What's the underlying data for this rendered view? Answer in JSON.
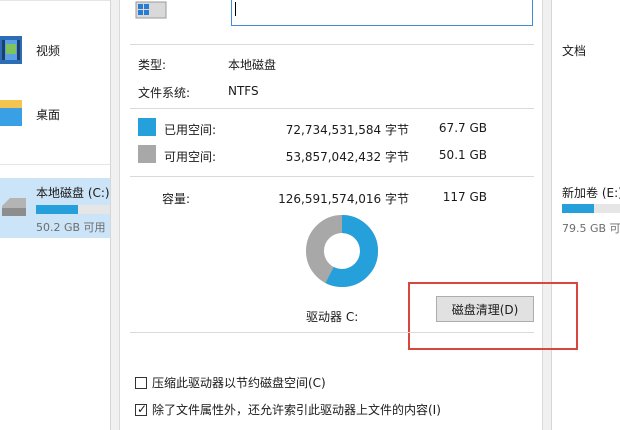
{
  "explorer": {
    "folders": [
      {
        "label": "视频",
        "icon": "video-folder-icon"
      },
      {
        "label": "桌面",
        "icon": "desktop-folder-icon"
      }
    ],
    "drive_c": {
      "label": "本地磁盘 (C:)",
      "free_text": "50.2 GB 可用",
      "used_fraction": 0.57
    },
    "right": {
      "doc_label": "文档",
      "drive_e": {
        "label": "新加卷 (E:)",
        "free_text": "79.5 GB 可",
        "used_fraction": 0.55
      }
    }
  },
  "properties": {
    "name_value": "",
    "type_label": "类型:",
    "type_value": "本地磁盘",
    "fs_label": "文件系统:",
    "fs_value": "NTFS",
    "used": {
      "label": "已用空间:",
      "bytes": "72,734,531,584 字节",
      "gb": "67.7 GB",
      "color": "#26a0da"
    },
    "free": {
      "label": "可用空间:",
      "bytes": "53,857,042,432 字节",
      "gb": "50.1 GB",
      "color": "#a8a8a8"
    },
    "capacity": {
      "label": "容量:",
      "bytes": "126,591,574,016 字节",
      "gb": "117 GB"
    },
    "used_fraction": 0.575,
    "drive_caption": "驱动器 C:",
    "cleanup_button": "磁盘清理(D)",
    "compress_label": "压缩此驱动器以节约磁盘空间(C)",
    "compress_checked": false,
    "index_label": "除了文件属性外，还允许索引此驱动器上文件的内容(I)",
    "index_checked": true
  },
  "colors": {
    "accent": "#26a0da",
    "highlight": "#d9463d"
  }
}
